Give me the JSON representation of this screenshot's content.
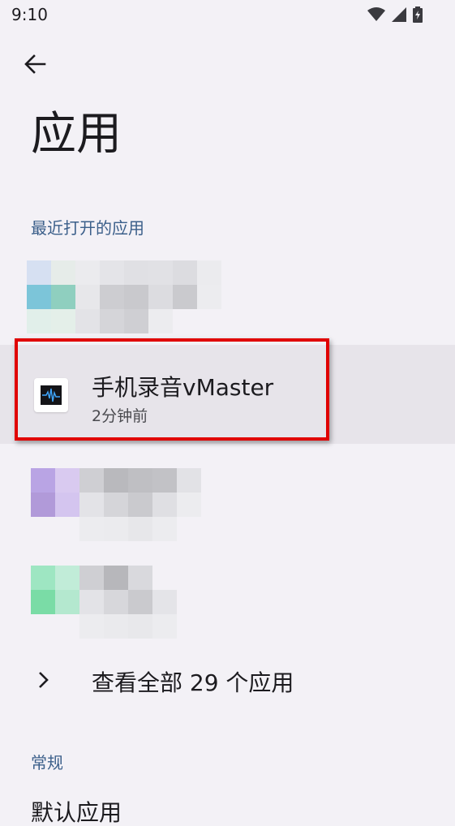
{
  "status_bar": {
    "time": "9:10",
    "icons": [
      "wifi-icon",
      "cellular-signal-icon",
      "battery-charging-icon"
    ]
  },
  "header": {
    "back_icon": "arrow-left-icon",
    "title": "应用"
  },
  "recent_section": {
    "header": "最近打开的应用",
    "highlighted_app": {
      "name": "手机录音vMaster",
      "time": "2分钟前",
      "icon": "audio-waveform-icon"
    }
  },
  "see_all": {
    "label": "查看全部 29 个应用",
    "icon": "chevron-right-icon"
  },
  "general_section": {
    "header": "常规",
    "partial_item": "默认应用"
  },
  "colors": {
    "background": "#f3f1f6",
    "section_header": "#3b5f8a",
    "highlight_frame": "#e00000",
    "selected_row": "#e7e4ea"
  }
}
